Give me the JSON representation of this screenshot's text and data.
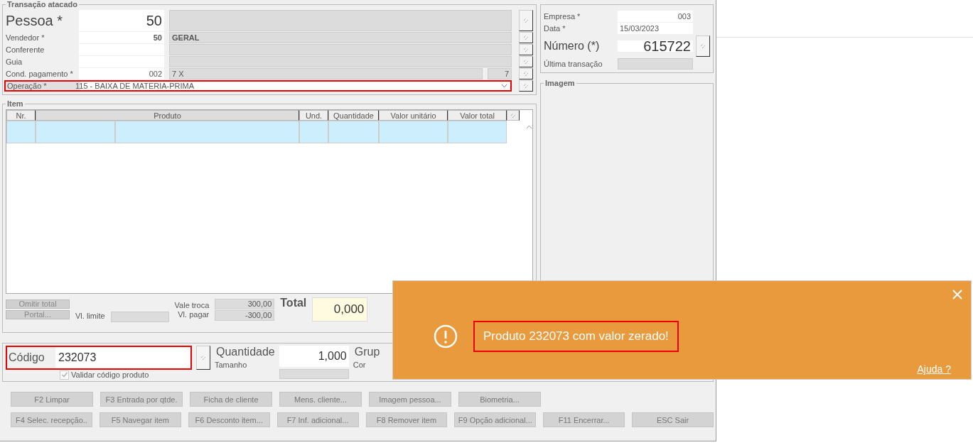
{
  "header": {
    "title": "Transação atacado",
    "pessoa": {
      "label": "Pessoa *",
      "code": "50"
    },
    "rows": [
      {
        "label": "Vendedor *",
        "code": "50",
        "name": "GERAL"
      },
      {
        "label": "Conferente"
      },
      {
        "label": "Guia"
      },
      {
        "label": "Cond. pagamento *",
        "code": "002",
        "name": "7 X",
        "extra": "7"
      }
    ],
    "operacao": {
      "label": "Operação *",
      "value": "115 - BAIXA DE MATERIA-PRIMA",
      "highlighted": true
    }
  },
  "company": {
    "empresa": {
      "label": "Empresa *",
      "value": "003"
    },
    "data": {
      "label": "Data *",
      "value": "15/03/2023"
    },
    "numero": {
      "label": "Número (*)",
      "value": "615722"
    },
    "ultima": {
      "label": "Última transação"
    }
  },
  "image_panel": {
    "title": "Imagem"
  },
  "items": {
    "title": "Item",
    "columns": [
      "Nr.",
      "Produto",
      "Und.",
      "Quantidade",
      "Valor unitário",
      "Valor total"
    ],
    "rows": [
      {
        "selected": true
      }
    ]
  },
  "totals": {
    "buttons": [
      "Omitir total",
      "Portal..."
    ],
    "limite_label": "Vl. limite",
    "vale_troca": {
      "label": "Vale troca",
      "value": "300,00"
    },
    "vl_pagar": {
      "label": "Vl. pagar",
      "value": "-300,00"
    },
    "total": {
      "label": "Total",
      "value": "0,000"
    }
  },
  "entry": {
    "codigo": {
      "label": "Código",
      "value": "232073",
      "highlighted": true
    },
    "validar": {
      "label": "Validar código produto",
      "checked": true
    },
    "quantidade": {
      "label": "Quantidade",
      "value": "1,000"
    },
    "tamanho_label": "Tamanho",
    "grupo_label": "Grup",
    "cor_label": "Cor"
  },
  "function_buttons": [
    [
      {
        "label": "F2 Limpar",
        "disabled": true
      },
      {
        "label": "F3 Entrada por qtde.",
        "disabled": true
      },
      {
        "label": "Ficha de cliente",
        "disabled": true
      },
      {
        "label": "Mens. cliente...",
        "disabled": true
      },
      {
        "label": "Imagem pessoa...",
        "disabled": true
      },
      {
        "label": "Biometria...",
        "disabled": true
      }
    ],
    [
      {
        "label": "F4 Selec. recepção..",
        "disabled": true
      },
      {
        "label": "F5 Navegar item",
        "disabled": true
      },
      {
        "label": "F6 Desconto item...",
        "disabled": true
      },
      {
        "label": "F7 Inf. adicional...",
        "disabled": true
      },
      {
        "label": "F8 Remover item",
        "disabled": true
      },
      {
        "label": "F9 Opção adicional...",
        "disabled": true
      },
      {
        "label": "F11 Encerrar...",
        "disabled": true
      },
      {
        "label": "ESC Sair",
        "disabled": true
      }
    ]
  ],
  "toast": {
    "message": "Produto 232073 com valor zerado!",
    "highlighted": true,
    "help": "Ajuda ?"
  }
}
